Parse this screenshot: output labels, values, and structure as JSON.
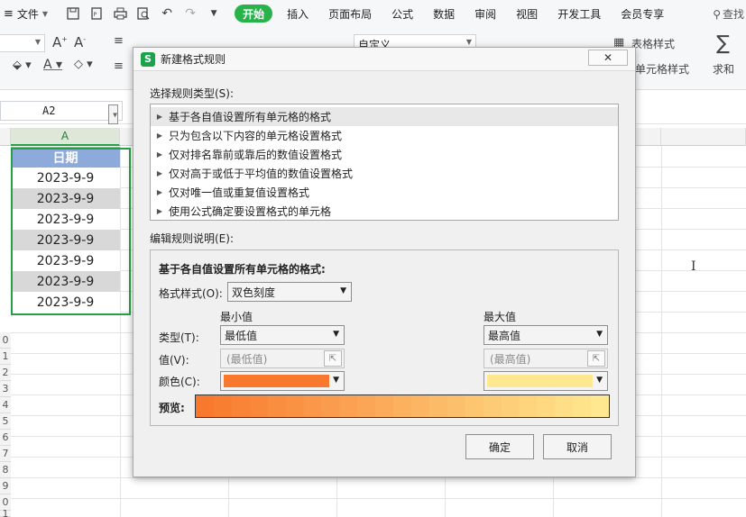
{
  "menubar": {
    "file_label": "文件",
    "tabs": [
      "开始",
      "插入",
      "页面布局",
      "公式",
      "数据",
      "审阅",
      "视图",
      "开发工具",
      "会员专享"
    ],
    "search_label": "查找"
  },
  "ribbon": {
    "number_format_value": "自定义",
    "table_style_label": "表格样式",
    "cell_style_label": "单元格样式",
    "sum_label": "求和"
  },
  "formula_bar": {
    "name_box": "A2"
  },
  "sheet": {
    "column_a": "A",
    "header_cell": "日期",
    "rows": [
      "2023-9-9",
      "2023-9-9",
      "2023-9-9",
      "2023-9-9",
      "2023-9-9",
      "2023-9-9",
      "2023-9-9"
    ],
    "row_numbers": [
      "0",
      "1",
      "2",
      "3",
      "4",
      "5",
      "6",
      "7",
      "8",
      "9",
      "0",
      "1"
    ],
    "header_color": "#8eaadb",
    "alt_row_color": "#d8d8d8",
    "selection_color": "#27a045"
  },
  "dialog": {
    "title": "新建格式规则",
    "rule_type_label": "选择规则类型(S):",
    "rule_types": [
      "基于各自值设置所有单元格的格式",
      "只为包含以下内容的单元格设置格式",
      "仅对排名靠前或靠后的数值设置格式",
      "仅对高于或低于平均值的数值设置格式",
      "仅对唯一值或重复值设置格式",
      "使用公式确定要设置格式的单元格"
    ],
    "edit_label": "编辑规则说明(E):",
    "group_title": "基于各自值设置所有单元格的格式:",
    "format_style_label": "格式样式(O):",
    "format_style_value": "双色刻度",
    "min_label": "最小值",
    "max_label": "最大值",
    "type_label": "类型(T):",
    "min_type": "最低值",
    "max_type": "最高值",
    "value_label": "值(V):",
    "min_value_placeholder": "(最低值)",
    "max_value_placeholder": "(最高值)",
    "color_label": "颜色(C):",
    "min_color": "#f8792e",
    "max_color": "#ffe88f",
    "preview_label": "预览:",
    "ok_label": "确定",
    "cancel_label": "取消"
  }
}
